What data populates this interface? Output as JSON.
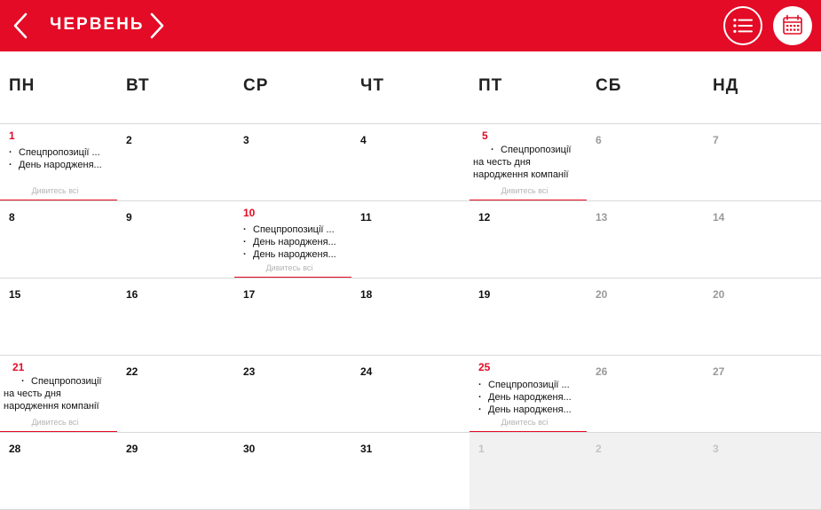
{
  "header": {
    "month": "ЧЕРВЕНЬ",
    "accent": "#e30b25"
  },
  "weekdays": [
    "ПН",
    "ВТ",
    "СР",
    "ЧТ",
    "ПТ",
    "СБ",
    "НД"
  ],
  "see_all_label": "Дивитесь всі",
  "events": {
    "d1": [
      "Спецпропозиції ...",
      "День народженя..."
    ],
    "d5": [
      "Спецпропозиції",
      "на честь дня",
      "народження компанії"
    ],
    "d10": [
      "Спецпропозиції ...",
      "День народженя...",
      "День народженя..."
    ],
    "d21": [
      "Спецпропозиції",
      "на честь дня",
      "народження компанії"
    ],
    "d25": [
      "Спецпропозиції ...",
      "День народженя...",
      "День народженя..."
    ]
  },
  "weeks": [
    [
      "1",
      "2",
      "3",
      "4",
      "5",
      "6",
      "7"
    ],
    [
      "8",
      "9",
      "10",
      "11",
      "12",
      "13",
      "14"
    ],
    [
      "15",
      "16",
      "17",
      "18",
      "19",
      "20",
      "20"
    ],
    [
      "21",
      "22",
      "23",
      "24",
      "25",
      "26",
      "27"
    ],
    [
      "28",
      "29",
      "30",
      "31",
      "1",
      "2",
      "3"
    ]
  ]
}
